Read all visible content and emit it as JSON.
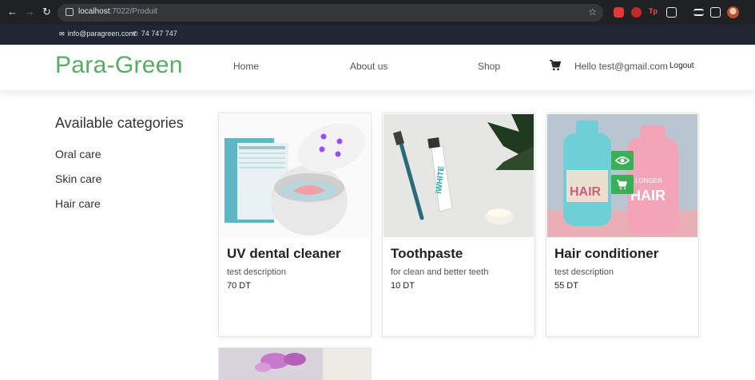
{
  "browser": {
    "url_host": "localhost",
    "url_path": ":7022/Produit"
  },
  "topbar": {
    "email": "info@paragreen.com",
    "phone": "74 747 747"
  },
  "header": {
    "brand": "Para-Green",
    "nav": [
      {
        "label": "Home"
      },
      {
        "label": "About us"
      },
      {
        "label": "Shop"
      }
    ],
    "greeting": "Hello test@gmail.com",
    "logout": "Logout"
  },
  "sidebar": {
    "title": "Available categories",
    "categories": [
      {
        "label": "Oral care"
      },
      {
        "label": "Skin care"
      },
      {
        "label": "Hair care"
      }
    ]
  },
  "products": [
    {
      "title": "UV dental cleaner",
      "description": "test description",
      "price": "70 DT"
    },
    {
      "title": "Toothpaste",
      "description": "for clean and better teeth",
      "price": "10 DT"
    },
    {
      "title": "Hair conditioner",
      "description": "test description",
      "price": "55 DT"
    }
  ],
  "colors": {
    "brand": "#5aaa67",
    "overlay_button": "#3cae55",
    "topbar": "#1f2733"
  },
  "icons": [
    "back-icon",
    "forward-icon",
    "reload-icon",
    "star-icon",
    "mail-icon",
    "phone-icon",
    "cart-icon",
    "eye-icon",
    "add-to-cart-icon"
  ]
}
